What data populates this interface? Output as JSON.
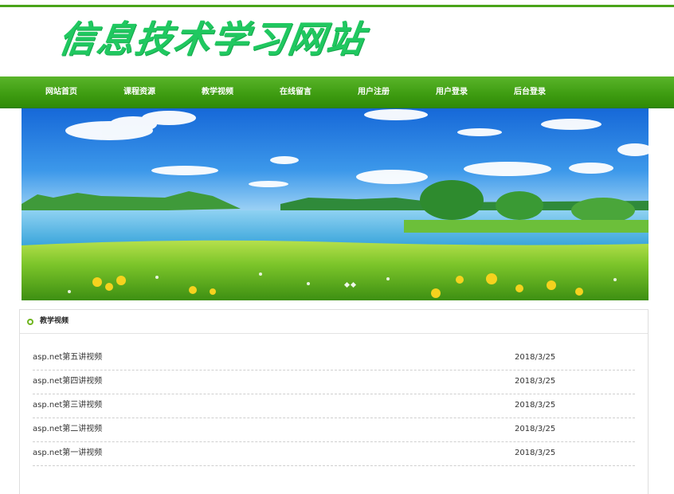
{
  "site": {
    "logo_text": "信息技术学习网站"
  },
  "nav": {
    "items": [
      {
        "label": "网站首页"
      },
      {
        "label": "课程资源"
      },
      {
        "label": "教学视频"
      },
      {
        "label": "在线留言"
      },
      {
        "label": "用户注册"
      },
      {
        "label": "用户登录"
      },
      {
        "label": "后台登录"
      }
    ]
  },
  "section": {
    "title": "教学视频",
    "rows": [
      {
        "title": "asp.net第五讲视频",
        "date": "2018/3/25"
      },
      {
        "title": "asp.net第四讲视频",
        "date": "2018/3/25"
      },
      {
        "title": "asp.net第三讲视频",
        "date": "2018/3/25"
      },
      {
        "title": "asp.net第二讲视频",
        "date": "2018/3/25"
      },
      {
        "title": "asp.net第一讲视频",
        "date": "2018/3/25"
      }
    ]
  },
  "colors": {
    "brand_green": "#4aa419",
    "logo_green": "#20c860",
    "sky_blue": "#1f7fe0"
  },
  "icons": {
    "section_bullet": "circle-bullet-icon"
  }
}
